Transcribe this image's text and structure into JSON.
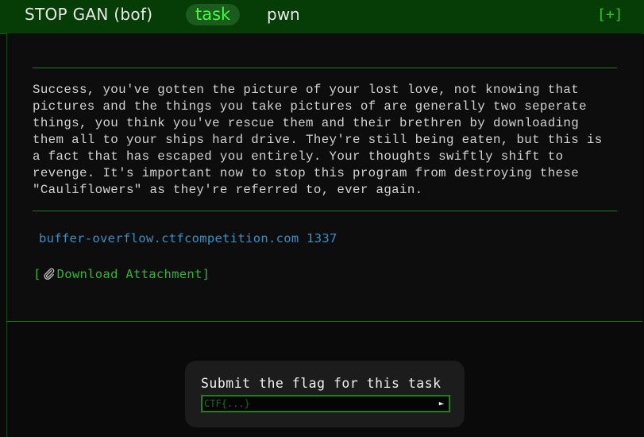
{
  "header": {
    "title": "STOP GAN (bof)",
    "badge": "task",
    "category": "pwn",
    "expand": "[+]"
  },
  "task": {
    "description": "Success, you've gotten the picture of your lost love, not knowing that\npictures and the things you take pictures of are generally two seperate\nthings, you think you've rescue them and their brethren by downloading\nthem all to your ships hard drive. They're still being eaten, but this is\na fact that has escaped you entirely. Your thoughts swiftly shift to\nrevenge. It's important now to stop this program from destroying these\n\"Cauliflowers\" as they're referred to, ever again.",
    "host": "buffer-overflow.ctfcompetition.com 1337",
    "download_open": "[",
    "download_label": "Download Attachment]",
    "clip_icon": "paperclip-icon"
  },
  "submit": {
    "label": "Submit the flag for this task",
    "placeholder": "CTF{...}",
    "value": "",
    "button": "►"
  },
  "colors": {
    "header_bg": "#063d06",
    "badge_bg": "#1d5a1d",
    "badge_text": "#3fff3f",
    "accent_green": "#2fb52f",
    "link_blue": "#3a8ec6"
  }
}
